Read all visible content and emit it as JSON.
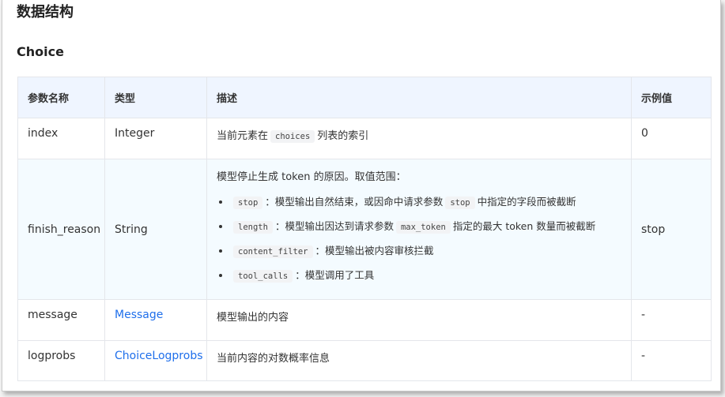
{
  "headings": {
    "section": "数据结构",
    "subsection": "Choice"
  },
  "table": {
    "headers": [
      "参数名称",
      "类型",
      "描述",
      "示例值"
    ],
    "rows": {
      "index": {
        "name": "index",
        "type": "Integer",
        "desc_before": "当前元素在",
        "desc_code": "choices",
        "desc_after": "列表的索引",
        "example": "0"
      },
      "finish_reason": {
        "name": "finish_reason",
        "type": "String",
        "desc_intro": "模型停止生成 token 的原因。取值范围：",
        "items": [
          {
            "code": "stop",
            "text1": "：模型输出自然结束，或因命中请求参数",
            "code2": "stop",
            "text2": "中指定的字段而被截断"
          },
          {
            "code": "length",
            "text1": "：模型输出因达到请求参数",
            "code2": "max_token",
            "text2": "指定的最大 token 数量而被截断"
          },
          {
            "code": "content_filter",
            "text1": "：模型输出被内容审核拦截"
          },
          {
            "code": "tool_calls",
            "text1": "：模型调用了工具"
          }
        ],
        "example": "stop"
      },
      "message": {
        "name": "message",
        "type": "Message",
        "desc": "模型输出的内容",
        "example": "-"
      },
      "logprobs": {
        "name": "logprobs",
        "type": "ChoiceLogprobs",
        "desc": "当前内容的对数概率信息",
        "example": "-"
      }
    }
  }
}
